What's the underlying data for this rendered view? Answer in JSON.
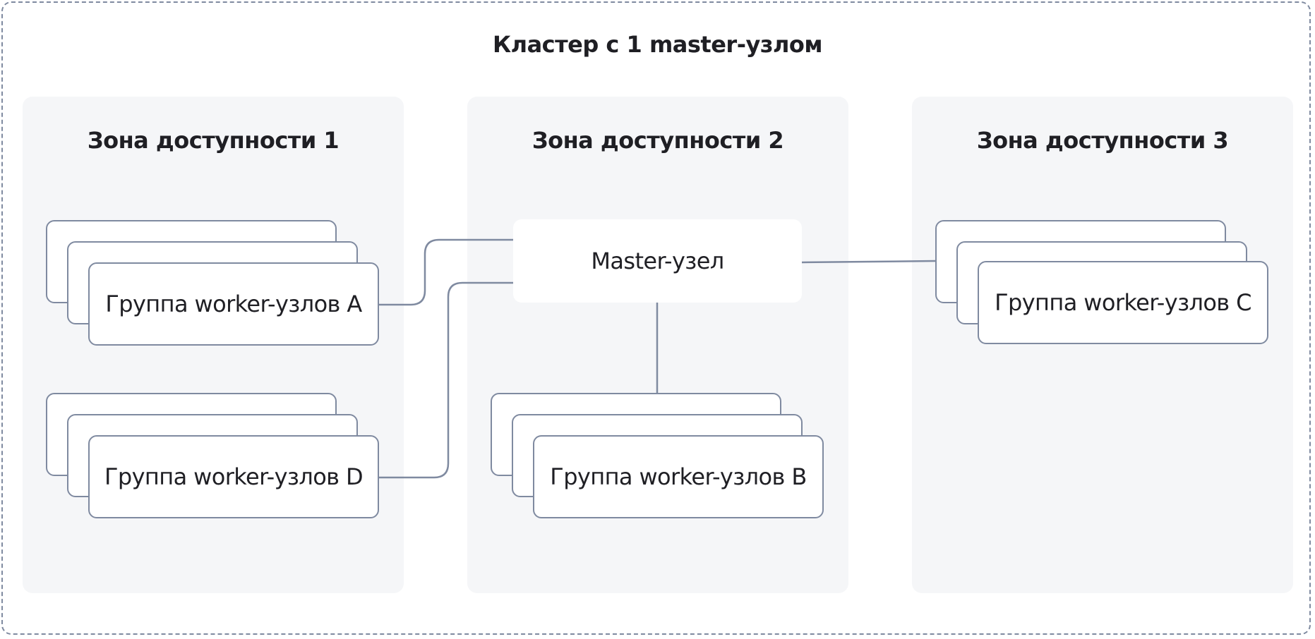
{
  "diagram": {
    "title": "Кластер с 1 master-узлом",
    "zones": [
      {
        "id": "zone1",
        "title": "Зона доступности 1"
      },
      {
        "id": "zone2",
        "title": "Зона доступности 2"
      },
      {
        "id": "zone3",
        "title": "Зона доступности 3"
      }
    ],
    "master": {
      "label": "Master-узел"
    },
    "groups": [
      {
        "id": "A",
        "label": "Группа worker-узлов A"
      },
      {
        "id": "D",
        "label": "Группа worker-узлов D"
      },
      {
        "id": "B",
        "label": "Группа worker-узлов B"
      },
      {
        "id": "C",
        "label": "Группа worker-узлов C"
      }
    ],
    "colors": {
      "border": "#7f8aa0",
      "zone_background": "#f5f6f8",
      "text": "#1f1f24"
    }
  }
}
